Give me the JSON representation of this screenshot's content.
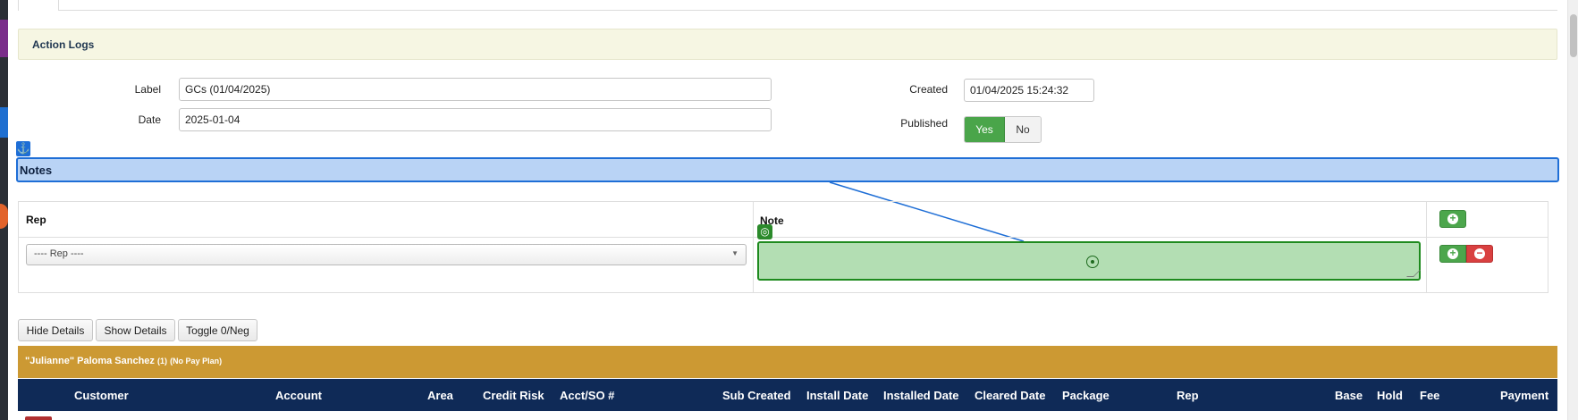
{
  "section": {
    "title": "Action Logs"
  },
  "form": {
    "label": {
      "caption": "Label",
      "value": "GCs (01/04/2025)"
    },
    "date": {
      "caption": "Date",
      "value": "2025-01-04"
    },
    "created": {
      "caption": "Created",
      "value": "01/04/2025 15:24:32"
    },
    "published": {
      "caption": "Published",
      "yes": "Yes",
      "no": "No",
      "selected": "Yes"
    }
  },
  "notes": {
    "title": "Notes",
    "columns": {
      "rep": "Rep",
      "note": "Note"
    },
    "rep_select": {
      "placeholder": "---- Rep ----"
    },
    "note_value": ""
  },
  "detail_buttons": {
    "hide": "Hide Details",
    "show": "Show Details",
    "toggle": "Toggle 0/Neg"
  },
  "group": {
    "name": "\"Julianne\" Paloma Sanchez",
    "count": "(1)",
    "plan": "(No Pay Plan)"
  },
  "table_columns": [
    "Customer",
    "Account",
    "Area",
    "Credit Risk",
    "Acct/SO #",
    "Sub Created",
    "Install Date",
    "Installed Date",
    "Cleared Date",
    "Package",
    "Rep",
    "Base",
    "Hold",
    "Fee",
    "Payment"
  ],
  "colors": {
    "section_bg": "#f6f6e3",
    "notes_highlight": "#b9d3f5",
    "accent_blue": "#1e6ed6",
    "green": "#4aa54a",
    "red": "#d94040",
    "group_bar": "#cc9933",
    "header_navy": "#0f2a57"
  }
}
